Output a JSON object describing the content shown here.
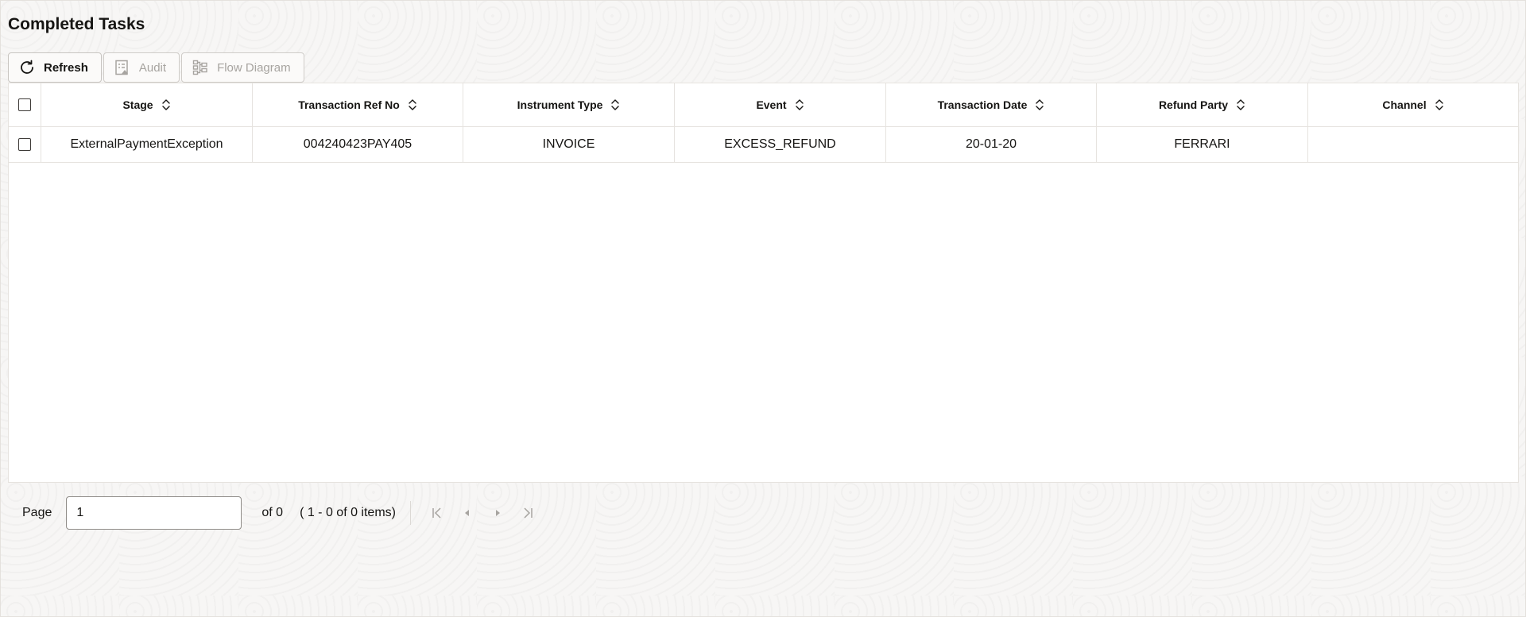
{
  "page": {
    "title": "Completed Tasks"
  },
  "toolbar": {
    "refresh_label": "Refresh",
    "audit_label": "Audit",
    "flow_diagram_label": "Flow Diagram"
  },
  "table": {
    "columns": [
      "Stage",
      "Transaction Ref No",
      "Instrument Type",
      "Event",
      "Transaction Date",
      "Refund Party",
      "Channel"
    ],
    "rows": [
      {
        "stage": "ExternalPaymentException",
        "transaction_ref_no": "004240423PAY405",
        "instrument_type": "INVOICE",
        "event": "EXCESS_REFUND",
        "transaction_date": "20-01-20",
        "refund_party": "FERRARI",
        "channel": ""
      }
    ]
  },
  "pagination": {
    "page_label": "Page",
    "page_value": "1",
    "of_total": "of 0",
    "range_text": "( 1 - 0 of 0 items)"
  },
  "icons": {
    "refresh": "refresh-icon",
    "audit": "audit-icon",
    "flow_diagram": "flow-diagram-icon",
    "sort": "sort-icon",
    "first": "first-page-icon",
    "prev": "previous-page-icon",
    "next": "next-page-icon",
    "last": "last-page-icon"
  },
  "colors": {
    "text": "#161513",
    "disabled_text": "#a7a4a0",
    "background": "#f7f6f5"
  }
}
